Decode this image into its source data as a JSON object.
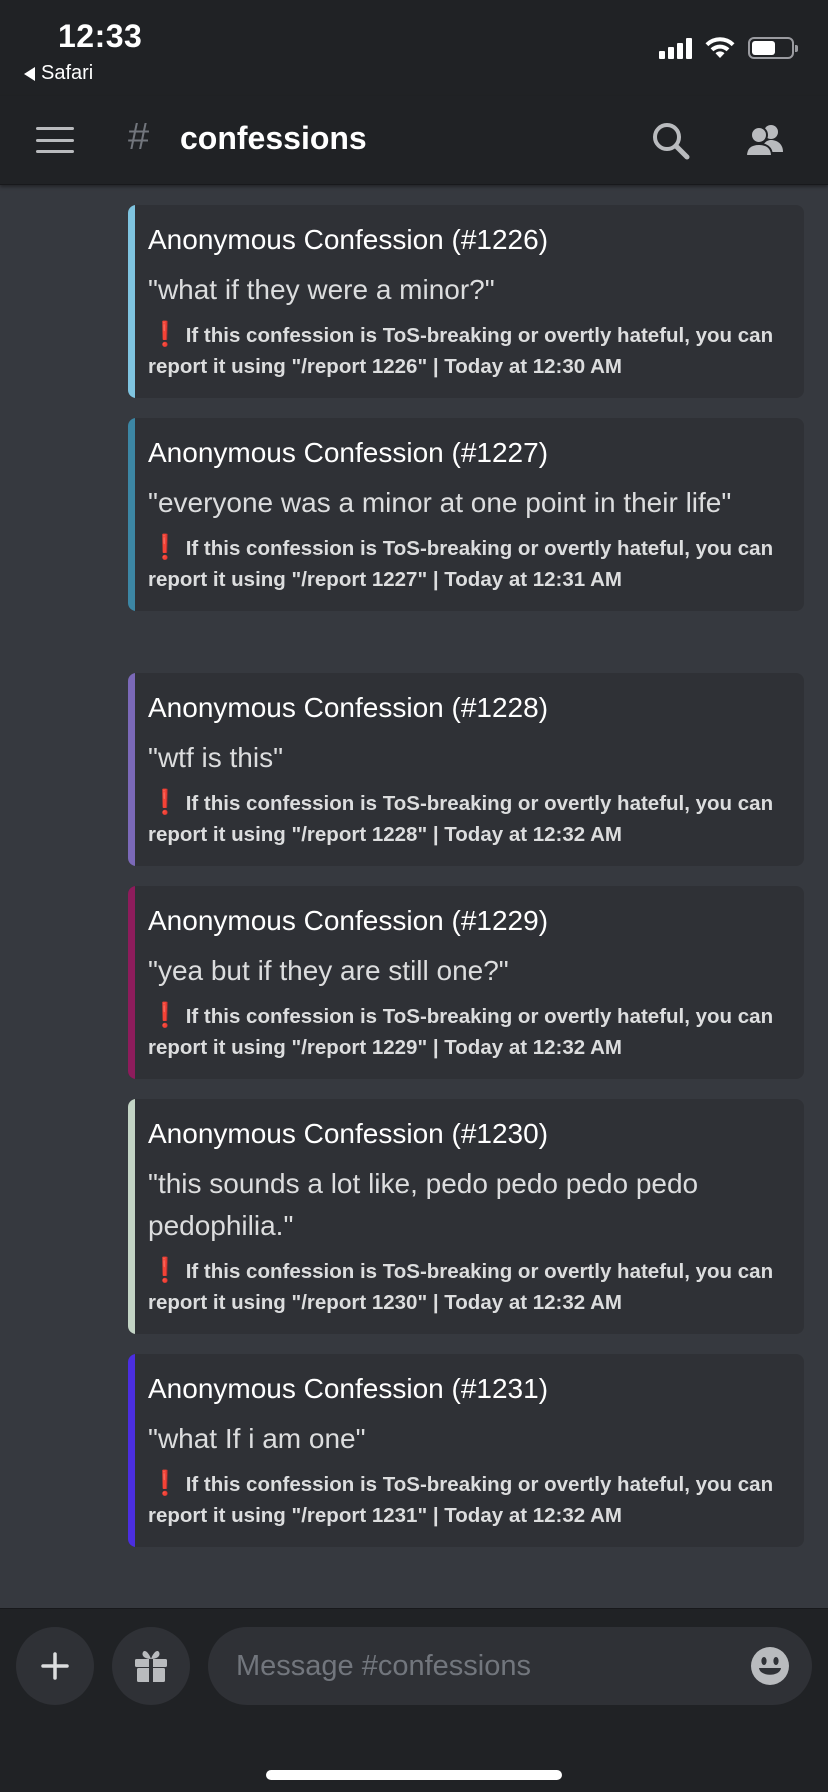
{
  "status_bar": {
    "time": "12:33",
    "back_app": "Safari"
  },
  "header": {
    "hash": "#",
    "channel_name": "confessions",
    "icons": [
      "menu-icon",
      "search-icon",
      "members-icon"
    ]
  },
  "messages": [
    {
      "title": "Anonymous Confession (#1226)",
      "text": "\"what if they were a minor?\"",
      "footer": "If this confession is ToS-breaking or overtly hateful, you can report it using \"/report 1226\" | Today at 12:30 AM",
      "color": "#7fc4e0"
    },
    {
      "title": "Anonymous Confession (#1227)",
      "text": "\"everyone was a minor at one point in their life\"",
      "footer": "If this confession is ToS-breaking or overtly hateful, you can report it using \"/report 1227\" | Today at 12:31 AM",
      "color": "#3c86a4"
    },
    {
      "title": "Anonymous Confession (#1228)",
      "text": "\"wtf is this\"",
      "footer": "If this confession is ToS-breaking or overtly hateful, you can report it using \"/report 1228\" | Today at 12:32 AM",
      "color": "#7b69b8"
    },
    {
      "title": "Anonymous Confession (#1229)",
      "text": "\"yea but if they are still one?\"",
      "footer": "If this confession is ToS-breaking or overtly hateful, you can report it using \"/report 1229\" | Today at 12:32 AM",
      "color": "#8e1c5c"
    },
    {
      "title": "Anonymous Confession (#1230)",
      "text": "\"this sounds a lot like, pedo pedo pedo pedo pedophilia.\"",
      "footer": "If this confession is ToS-breaking or overtly hateful, you can report it using \"/report 1230\" | Today at 12:32 AM",
      "color": "#c3d4c5"
    },
    {
      "title": "Anonymous Confession (#1231)",
      "text": "\"what If i am one\"",
      "footer": "If this confession is ToS-breaking or overtly hateful, you can report it using \"/report 1231\" | Today at 12:32 AM",
      "color": "#4b2ee0"
    }
  ],
  "warning_glyph": "❗",
  "composer": {
    "placeholder": "Message #confessions",
    "icons": [
      "plus-icon",
      "gift-icon",
      "emoji-icon"
    ]
  }
}
